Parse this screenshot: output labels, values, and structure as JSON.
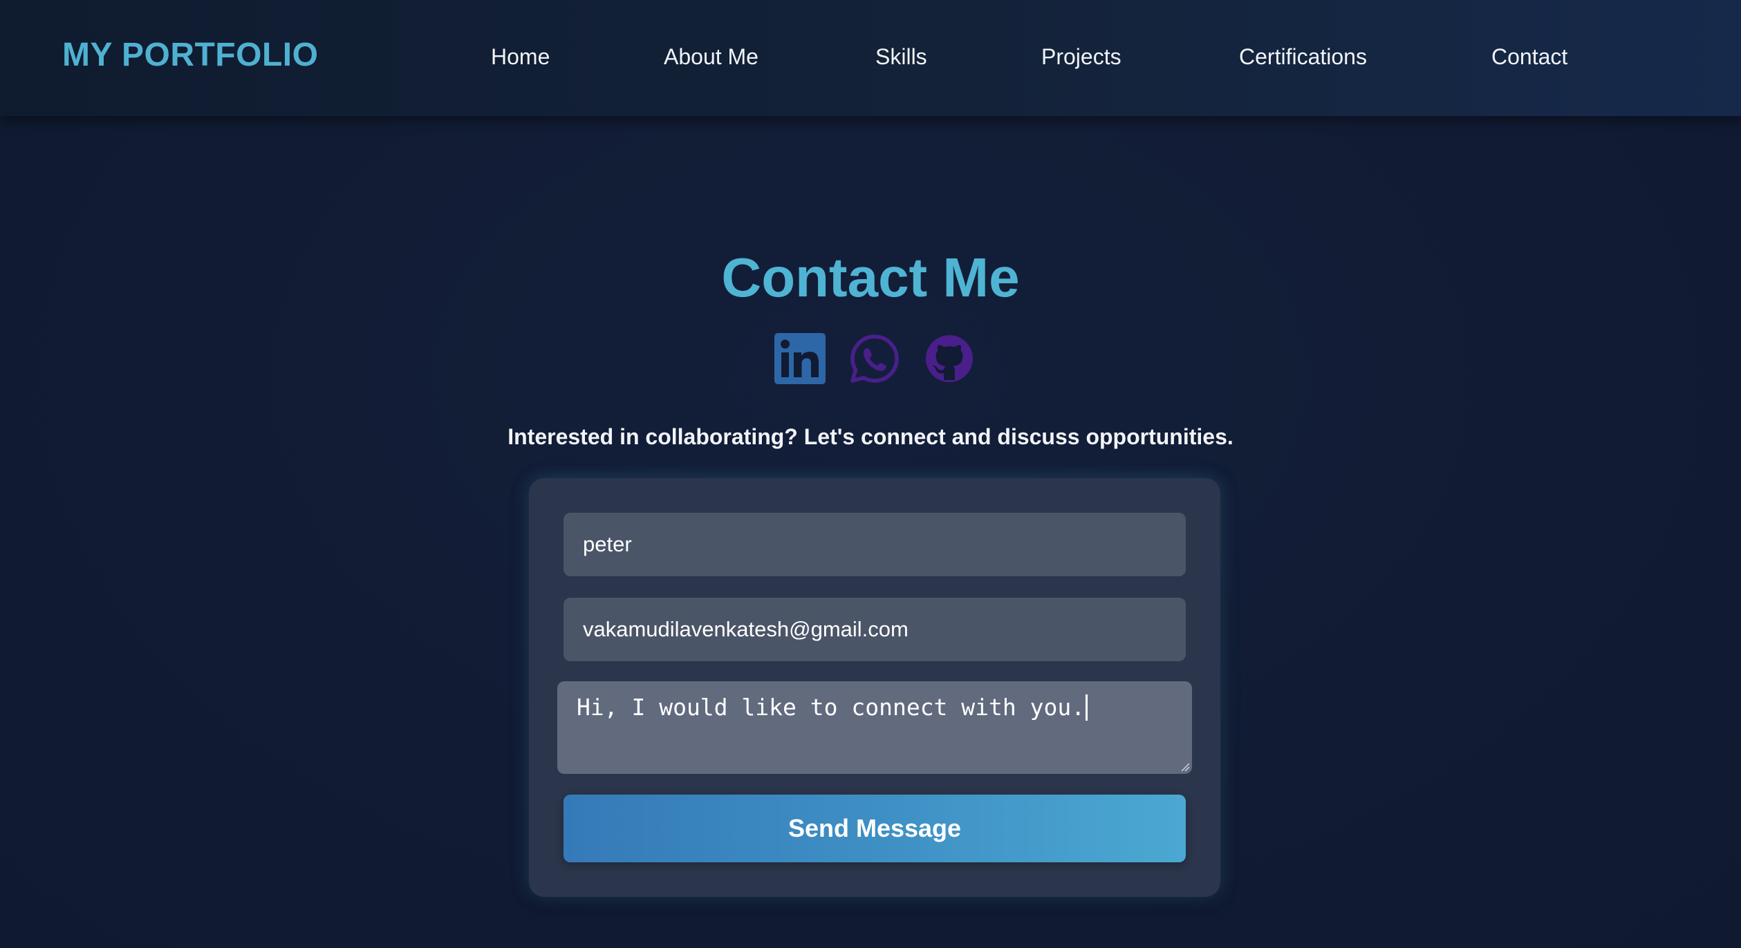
{
  "header": {
    "brand": "MY PORTFOLIO",
    "nav": [
      {
        "label": "Home"
      },
      {
        "label": "About Me"
      },
      {
        "label": "Skills"
      },
      {
        "label": "Projects"
      },
      {
        "label": "Certifications"
      },
      {
        "label": "Contact"
      }
    ]
  },
  "contact": {
    "title": "Contact Me",
    "socials": [
      {
        "icon": "linkedin-icon",
        "color": "#2d67a8"
      },
      {
        "icon": "whatsapp-icon",
        "color": "#4a1f8c"
      },
      {
        "icon": "github-icon",
        "color": "#4a1f8c"
      }
    ],
    "tagline": "Interested in collaborating? Let's connect and discuss opportunities.",
    "form": {
      "name_value": "peter",
      "email_value": "vakamudilavenkatesh@gmail.com",
      "message_value": "Hi, I would like to connect with you.",
      "submit_label": "Send Message"
    }
  },
  "colors": {
    "accent": "#4fb1d1",
    "background": "#121c35",
    "card": "#2b354b",
    "input": "#4b5568",
    "button_start": "#357ab8",
    "button_end": "#4ba8d2"
  }
}
